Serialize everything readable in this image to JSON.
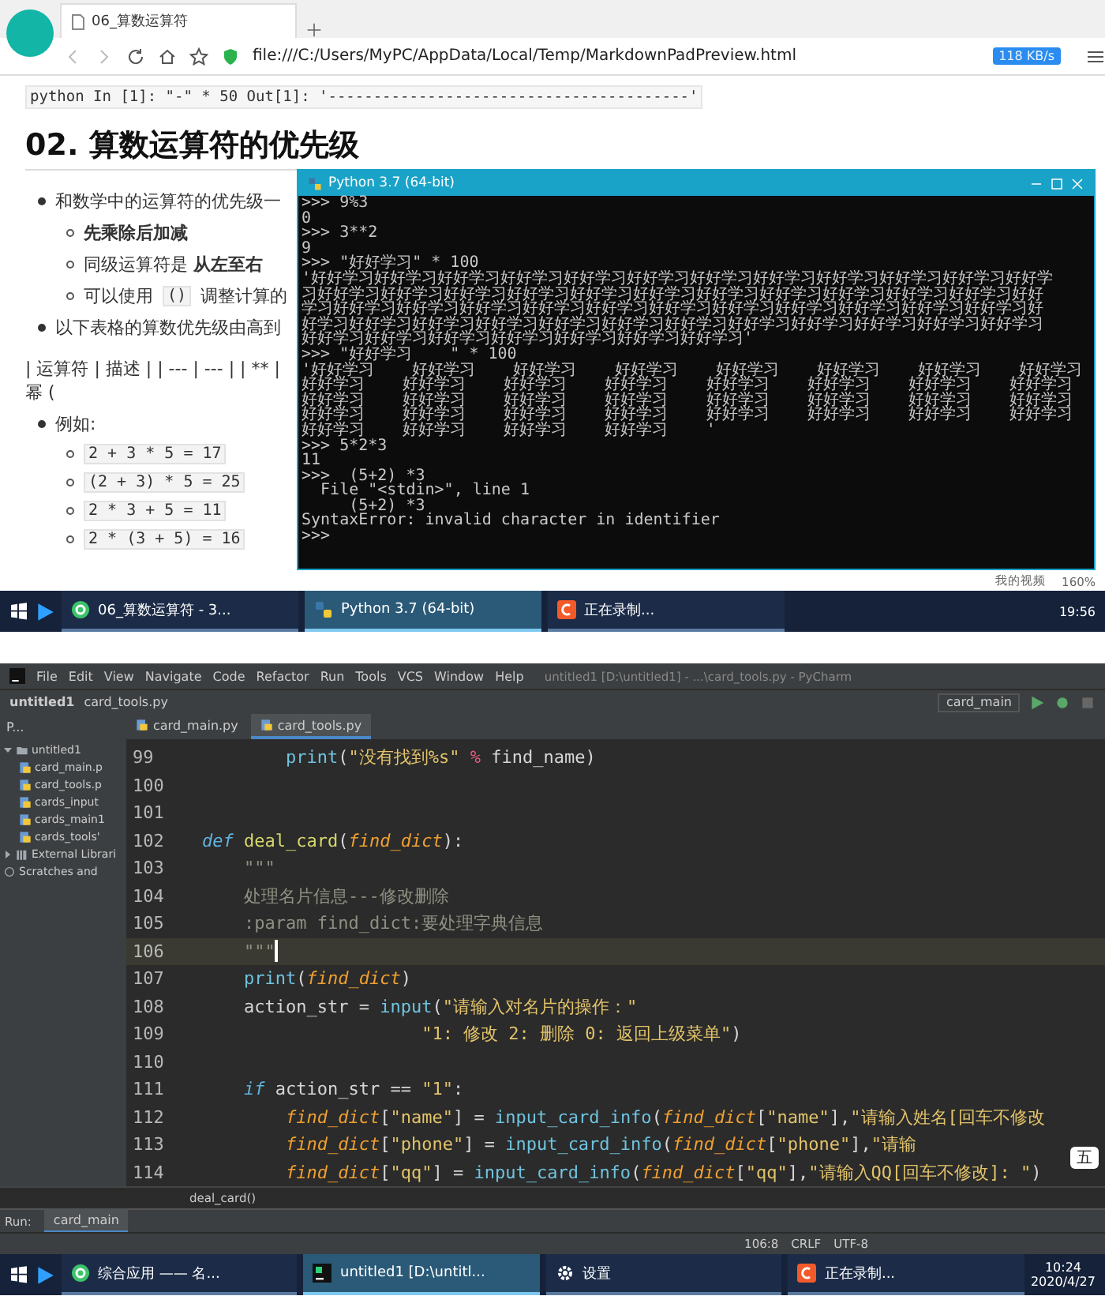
{
  "browser": {
    "tab": "06_算数运算符",
    "address": "file:///C:/Users/MyPC/AppData/Local/Temp/MarkdownPadPreview.html",
    "speed": "118 KB/s"
  },
  "doc": {
    "code_line": "python In [1]: \"-\" * 50 Out[1]: '----------------------------------------'",
    "heading": "02. 算数运算符的优先级",
    "bullets": [
      {
        "text": "和数学中的运算符的优先级一",
        "children": [
          {
            "segments": [
              {
                "kind": "text",
                "text": "**先乘除后加减**"
              }
            ]
          },
          {
            "segments": [
              {
                "kind": "text",
                "text": "同级运算符是 **从左至右**"
              }
            ]
          },
          {
            "segments": [
              {
                "kind": "text",
                "text": "可以使用"
              },
              {
                "kind": "code",
                "text": "()"
              },
              {
                "kind": "text",
                "text": "调整计算的"
              }
            ]
          }
        ]
      },
      {
        "text": "以下表格的算数优先级由高到"
      }
    ],
    "table_text": "| 运算符 | 描述 | | --- | --- | | ** | 幂 (",
    "examples_label": "例如:",
    "examples": [
      "2 + 3 * 5 = 17",
      "(2 + 3) * 5 = 25",
      "2 * 3 + 5 = 11",
      "2 * (3 + 5) = 16"
    ]
  },
  "console": {
    "title": "Python 3.7 (64-bit)",
    "lines": [
      ">>> 9%3",
      "0",
      ">>> 3**2",
      "9",
      ">>> \"好好学习\" * 100",
      "'好好学习好好学习好好学习好好学习好好学习好好学习好好学习好好学习好好学习好好学习好好学习好好学",
      "习好好学习好好学习好好学习好好学习好好学习好好学习好好学习好好学习好好学习好好学习好好学习好好",
      "学习好好学习好好学习好好学习好好学习好好学习好好学习好好学习好好学习好好学习好好学习好好学习好",
      "好学习好好学习好好学习好好学习好好学习好好学习好好学习好好学习好好学习好好学习好好学习好好学习",
      "好好学习好好学习好好学习好好学习好好学习好好学习好好学习'",
      ">>> \"好好学习    \" * 100",
      "'好好学习    好好学习    好好学习    好好学习    好好学习    好好学习    好好学习    好好学习",
      "好好学习    好好学习    好好学习    好好学习    好好学习    好好学习    好好学习    好好学习",
      "好好学习    好好学习    好好学习    好好学习    好好学习    好好学习    好好学习    好好学习",
      "好好学习    好好学习    好好学习    好好学习    好好学习    好好学习    好好学习    好好学习",
      "好好学习    好好学习    好好学习    好好学习    '",
      ">>> 5*2*3",
      "11",
      ">>>  (5+2) *3",
      "  File \"<stdin>\", line 1",
      "     (5+2) *3",
      "SyntaxError: invalid character in identifier",
      ">>>"
    ]
  },
  "top_status": {
    "video": "我的视频",
    "zoom": "160%"
  },
  "top_taskbar": {
    "items": [
      {
        "kind": "browser",
        "label": "06_算数运算符 - 3...",
        "selected": false
      },
      {
        "kind": "python",
        "label": "Python 3.7 (64-bit)",
        "selected": true
      },
      {
        "kind": "recorder",
        "label": "正在录制...",
        "selected": false
      }
    ],
    "time": "19:56"
  },
  "ide": {
    "title": "untitled1 [D:\\untitled1] - ...\\card_tools.py - PyCharm",
    "menu": [
      "File",
      "Edit",
      "View",
      "Navigate",
      "Code",
      "Refactor",
      "Run",
      "Tools",
      "VCS",
      "Window",
      "Help"
    ],
    "breadcrumbs": [
      "untitled1",
      "card_tools.py"
    ],
    "run_config": "card_main",
    "project_view": "P...",
    "tabs": [
      {
        "label": "card_main.py",
        "selected": false
      },
      {
        "label": "card_tools.py",
        "selected": true
      }
    ],
    "tree": [
      {
        "label": "untitled1",
        "kind": "folder",
        "expanded": true,
        "children": [
          {
            "label": "card_main.p",
            "kind": "file"
          },
          {
            "label": "card_tools.p",
            "kind": "file"
          },
          {
            "label": "cards_input",
            "kind": "file"
          },
          {
            "label": "cards_main1",
            "kind": "file"
          },
          {
            "label": "cards_tools'",
            "kind": "file"
          }
        ]
      },
      {
        "label": "External Librari",
        "kind": "library",
        "expanded": false
      },
      {
        "label": "Scratches and",
        "kind": "scratch"
      }
    ],
    "code": [
      {
        "number": "99",
        "current": false,
        "tokens": [
          {
            "kind": "builtin",
            "text": "        print"
          },
          {
            "kind": "plain",
            "text": "("
          },
          {
            "kind": "str",
            "text": "\"没有找到%s\""
          },
          {
            "kind": "op",
            "text": " %"
          },
          {
            "kind": "plain",
            "text": " find_name)"
          }
        ]
      },
      {
        "number": "100",
        "current": false
      },
      {
        "number": "101",
        "current": false
      },
      {
        "number": "102",
        "current": false,
        "tokens": [
          {
            "kind": "kw",
            "text": "def"
          },
          {
            "kind": "fn",
            "text": " deal_card"
          },
          {
            "kind": "plain",
            "text": "("
          },
          {
            "kind": "param",
            "text": "find_dict"
          },
          {
            "kind": "plain",
            "text": "):"
          }
        ]
      },
      {
        "number": "103",
        "current": false,
        "tokens": [
          {
            "kind": "doc",
            "text": "    \"\"\""
          }
        ]
      },
      {
        "number": "104",
        "current": false,
        "tokens": [
          {
            "kind": "doc",
            "text": "    处理名片信息---修改删除"
          }
        ]
      },
      {
        "number": "105",
        "current": false,
        "tokens": [
          {
            "kind": "doc",
            "text": "    :param find_dict:要处理字典信息"
          }
        ]
      },
      {
        "number": "106",
        "current": true,
        "tokens": [
          {
            "kind": "doc",
            "text": "    \"\"\""
          }
        ]
      },
      {
        "number": "107",
        "current": false,
        "tokens": [
          {
            "kind": "builtin",
            "text": "    print"
          },
          {
            "kind": "plain",
            "text": "("
          },
          {
            "kind": "param",
            "text": "find_dict"
          },
          {
            "kind": "plain",
            "text": ")"
          }
        ]
      },
      {
        "number": "108",
        "current": false,
        "tokens": [
          {
            "kind": "plain",
            "text": "    action_str = "
          },
          {
            "kind": "builtin",
            "text": "input"
          },
          {
            "kind": "plain",
            "text": "("
          },
          {
            "kind": "str",
            "text": "\"请输入对名片的操作：\""
          }
        ]
      },
      {
        "number": "109",
        "current": false,
        "tokens": [
          {
            "kind": "str",
            "text": "                     \"1: 修改 2: 删除 0: 返回上级菜单\""
          },
          {
            "kind": "plain",
            "text": ")"
          }
        ]
      },
      {
        "number": "110",
        "current": false
      },
      {
        "number": "111",
        "current": false,
        "tokens": [
          {
            "kind": "kw",
            "text": "    if"
          },
          {
            "kind": "plain",
            "text": " action_str == "
          },
          {
            "kind": "str",
            "text": "\"1\""
          },
          {
            "kind": "plain",
            "text": ":"
          }
        ]
      },
      {
        "number": "112",
        "current": false,
        "tokens": [
          {
            "kind": "param",
            "text": "        find_dict"
          },
          {
            "kind": "plain",
            "text": "["
          },
          {
            "kind": "str",
            "text": "\"name\""
          },
          {
            "kind": "plain",
            "text": "] = "
          },
          {
            "kind": "builtin",
            "text": "input_card_info"
          },
          {
            "kind": "plain",
            "text": "("
          },
          {
            "kind": "param",
            "text": "find_dict"
          },
          {
            "kind": "plain",
            "text": "["
          },
          {
            "kind": "str",
            "text": "\"name\""
          },
          {
            "kind": "plain",
            "text": "],"
          },
          {
            "kind": "str",
            "text": "\"请输入姓名[回车不修改"
          }
        ]
      },
      {
        "number": "113",
        "current": false,
        "tokens": [
          {
            "kind": "param",
            "text": "        find_dict"
          },
          {
            "kind": "plain",
            "text": "["
          },
          {
            "kind": "str",
            "text": "\"phone\""
          },
          {
            "kind": "plain",
            "text": "] = "
          },
          {
            "kind": "builtin",
            "text": "input_card_info"
          },
          {
            "kind": "plain",
            "text": "("
          },
          {
            "kind": "param",
            "text": "find_dict"
          },
          {
            "kind": "plain",
            "text": "["
          },
          {
            "kind": "str",
            "text": "\"phone\""
          },
          {
            "kind": "plain",
            "text": "],"
          },
          {
            "kind": "str",
            "text": "\"请输"
          }
        ]
      },
      {
        "number": "114",
        "current": false,
        "tokens": [
          {
            "kind": "param",
            "text": "        find_dict"
          },
          {
            "kind": "plain",
            "text": "["
          },
          {
            "kind": "str",
            "text": "\"qq\""
          },
          {
            "kind": "plain",
            "text": "] = "
          },
          {
            "kind": "builtin",
            "text": "input_card_info"
          },
          {
            "kind": "plain",
            "text": "("
          },
          {
            "kind": "param",
            "text": "find_dict"
          },
          {
            "kind": "plain",
            "text": "["
          },
          {
            "kind": "str",
            "text": "\"qq\""
          },
          {
            "kind": "plain",
            "text": "],"
          },
          {
            "kind": "str",
            "text": "\"请输入QQ[回车不修改]: \""
          },
          {
            "kind": "plain",
            "text": ")"
          }
        ]
      }
    ],
    "ime": "五",
    "breadcrumb": "deal_card()",
    "run_label": "Run:",
    "run_tab": "card_main",
    "status": [
      "106:8",
      "CRLF",
      "UTF-8"
    ]
  },
  "bottom_taskbar": {
    "items": [
      {
        "kind": "app",
        "label": "综合应用 —— 名...",
        "selected": false
      },
      {
        "kind": "pycharm",
        "label": "untitled1 [D:\\untitl...",
        "selected": true
      },
      {
        "kind": "settings",
        "label": "设置",
        "selected": false
      },
      {
        "kind": "recorder",
        "label": "正在录制...",
        "selected": false
      }
    ],
    "time": "10:24",
    "date": "2020/4/27"
  }
}
